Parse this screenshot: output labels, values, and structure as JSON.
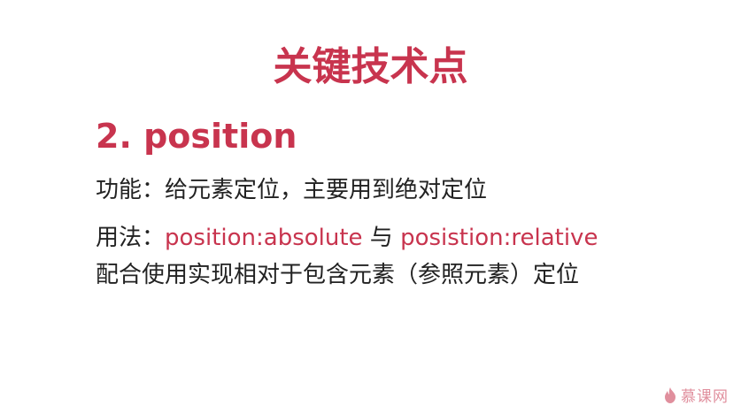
{
  "slide": {
    "title": "关键技术点",
    "subtitle": "2. position",
    "function_line": "功能：给元素定位，主要用到绝对定位",
    "usage_prefix": "用法：",
    "usage_code_1": "position:absolute",
    "usage_connector": " 与 ",
    "usage_code_2": "posistion:relative",
    "usage_line_2": "配合使用实现相对于包含元素（参照元素）定位"
  },
  "watermark": {
    "text": "慕课网",
    "icon": "flame-icon",
    "color": "#c8344e"
  },
  "colors": {
    "accent": "#c8344e",
    "body_text": "#222222",
    "background": "#ffffff"
  }
}
